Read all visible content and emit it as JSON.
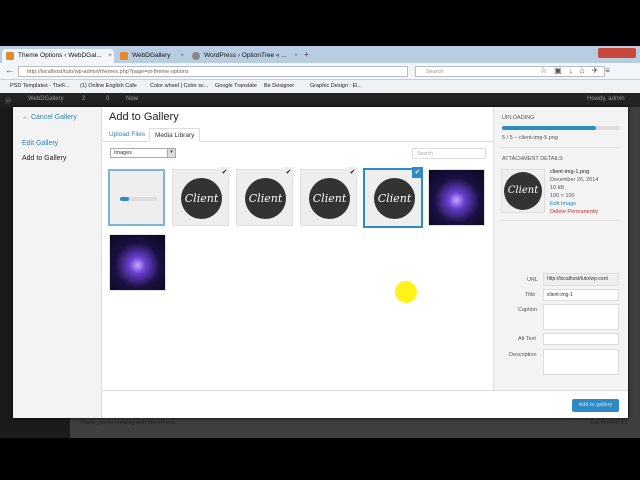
{
  "browser": {
    "tabs": [
      {
        "title": "Theme Options ‹ WebDGal..."
      },
      {
        "title": "WebDGallery"
      },
      {
        "title": "WordPress › OptionTree « ..."
      }
    ],
    "new_tab": "+",
    "url": "http://localhost/tuto/wp-admin/themes.php?page=ot-theme-options",
    "search_placeholder": "Search",
    "bookmarks": [
      "PSD Templates - TheF...",
      "(1) Online English Cafe",
      "Color wheel | Color sc...",
      "Google Translate",
      "Be Designer",
      "Graphic Design : El..."
    ]
  },
  "admin_bar": {
    "site": "WebDGallery",
    "updates": "2",
    "comments": "0",
    "new": "New",
    "howdy": "Howdy, admin"
  },
  "modal": {
    "title": "Add to Gallery",
    "close": "×",
    "menu": {
      "cancel": "← Cancel Gallery",
      "edit": "Edit Gallery",
      "add": "Add to Gallery"
    },
    "tabs": [
      {
        "label": "Upload Files"
      },
      {
        "label": "Media Library"
      }
    ],
    "filter": "Images",
    "search_placeholder": "Search",
    "thumb_text": "Client",
    "right": {
      "uploading_heading": "UPLOADING",
      "progress": 0.8,
      "upload_status": "5 / 5  –  client-img-5.png",
      "details_heading": "ATTACHMENT DETAILS",
      "filename": "client-img-1.png",
      "date": "December 26, 2014",
      "size": "10 kB",
      "dimensions": "100 × 100",
      "edit": "Edit Image",
      "delete": "Delete Permanently",
      "url_label": "URL",
      "url_value": "http://localhost/tuto/wp-cont",
      "title_label": "Title",
      "title_value": "client-img-1",
      "caption_label": "Caption",
      "alt_label": "Alt Text",
      "description_label": "Description"
    },
    "add_button": "Add to gallery"
  },
  "footer": {
    "thanks": "Thank you for creating with WordPress.",
    "version": "Get Version 4.1"
  }
}
